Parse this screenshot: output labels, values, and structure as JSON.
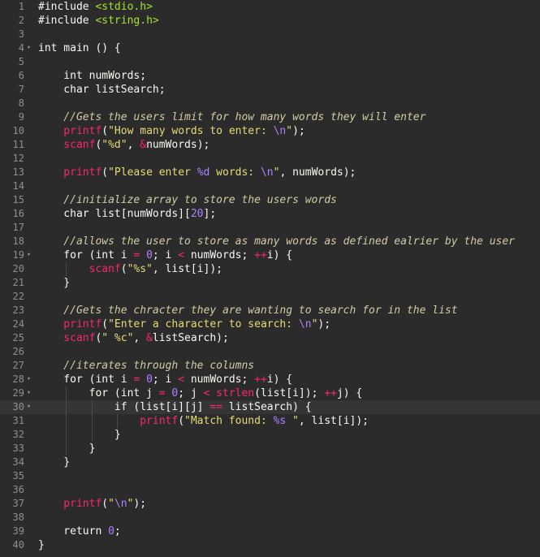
{
  "editor": {
    "colors": {
      "background": "#2b2b2b",
      "gutter_text": "#8f908a",
      "text": "#f8f8f2",
      "string": "#e6db74",
      "builtin": "#f92672",
      "number": "#ae81ff",
      "comment": "#d2cca5",
      "include": "#a6e22e"
    },
    "active_line": 30,
    "fold_lines": [
      4,
      19,
      28,
      29,
      30
    ],
    "lines": [
      [
        [
          "def",
          "#include "
        ],
        [
          "inc",
          "<stdio.h>"
        ]
      ],
      [
        [
          "def",
          "#include "
        ],
        [
          "inc",
          "<string.h>"
        ]
      ],
      [],
      [
        [
          "def",
          "int main () {"
        ]
      ],
      [],
      [
        [
          "def",
          "    int numWords;"
        ]
      ],
      [
        [
          "def",
          "    char listSearch;"
        ]
      ],
      [],
      [
        [
          "cmt",
          "    //Gets the users limit for how many words they will enter"
        ]
      ],
      [
        [
          "fn",
          "    printf"
        ],
        [
          "def",
          "("
        ],
        [
          "str",
          "\"How many words to enter: "
        ],
        [
          "esc",
          "\\n"
        ],
        [
          "str",
          "\""
        ],
        [
          "def",
          ");"
        ]
      ],
      [
        [
          "fn",
          "    scanf"
        ],
        [
          "def",
          "("
        ],
        [
          "str",
          "\"%d\""
        ],
        [
          "def",
          ", "
        ],
        [
          "op",
          "&"
        ],
        [
          "def",
          "numWords);"
        ]
      ],
      [],
      [
        [
          "fn",
          "    printf"
        ],
        [
          "def",
          "("
        ],
        [
          "str",
          "\"Please enter "
        ],
        [
          "esc",
          "%d"
        ],
        [
          "str",
          " words: "
        ],
        [
          "esc",
          "\\n"
        ],
        [
          "str",
          "\""
        ],
        [
          "def",
          ", numWords);"
        ]
      ],
      [],
      [
        [
          "cmt",
          "    //initialize array to store the users words"
        ]
      ],
      [
        [
          "def",
          "    char list[numWords]["
        ],
        [
          "num",
          "20"
        ],
        [
          "def",
          "];"
        ]
      ],
      [],
      [
        [
          "cmt",
          "    //allows the user to store as many words as defined ealrier by the user"
        ]
      ],
      [
        [
          "def",
          "    for (int i "
        ],
        [
          "op",
          "="
        ],
        [
          "def",
          " "
        ],
        [
          "num",
          "0"
        ],
        [
          "def",
          "; i "
        ],
        [
          "op",
          "<"
        ],
        [
          "def",
          " numWords; "
        ],
        [
          "op",
          "++"
        ],
        [
          "def",
          "i) {"
        ]
      ],
      [
        [
          "fn",
          "        scanf"
        ],
        [
          "def",
          "("
        ],
        [
          "str",
          "\"%s\""
        ],
        [
          "def",
          ", list[i]);"
        ]
      ],
      [
        [
          "def",
          "    }"
        ]
      ],
      [],
      [
        [
          "cmt",
          "    //Gets the chracter they are wanting to search for in the list"
        ]
      ],
      [
        [
          "fn",
          "    printf"
        ],
        [
          "def",
          "("
        ],
        [
          "str",
          "\"Enter a character to search: "
        ],
        [
          "esc",
          "\\n"
        ],
        [
          "str",
          "\""
        ],
        [
          "def",
          ");"
        ]
      ],
      [
        [
          "fn",
          "    scanf"
        ],
        [
          "def",
          "("
        ],
        [
          "str",
          "\" %c\""
        ],
        [
          "def",
          ", "
        ],
        [
          "op",
          "&"
        ],
        [
          "def",
          "listSearch);"
        ]
      ],
      [],
      [
        [
          "cmt",
          "    //iterates through the columns"
        ]
      ],
      [
        [
          "def",
          "    for (int i "
        ],
        [
          "op",
          "="
        ],
        [
          "def",
          " "
        ],
        [
          "num",
          "0"
        ],
        [
          "def",
          "; i "
        ],
        [
          "op",
          "<"
        ],
        [
          "def",
          " numWords; "
        ],
        [
          "op",
          "++"
        ],
        [
          "def",
          "i) {"
        ]
      ],
      [
        [
          "def",
          "        for (int j "
        ],
        [
          "op",
          "="
        ],
        [
          "def",
          " "
        ],
        [
          "num",
          "0"
        ],
        [
          "def",
          "; j "
        ],
        [
          "op",
          "<"
        ],
        [
          "def",
          " "
        ],
        [
          "fn",
          "strlen"
        ],
        [
          "def",
          "(list[i]); "
        ],
        [
          "op",
          "++"
        ],
        [
          "def",
          "j) {"
        ]
      ],
      [
        [
          "def",
          "            if (list[i][j] "
        ],
        [
          "op",
          "=="
        ],
        [
          "def",
          " listSearch) {"
        ]
      ],
      [
        [
          "fn",
          "                printf"
        ],
        [
          "def",
          "("
        ],
        [
          "str",
          "\"Match found: "
        ],
        [
          "esc",
          "%s"
        ],
        [
          "str",
          " \""
        ],
        [
          "def",
          ", list[i]);"
        ]
      ],
      [
        [
          "def",
          "            }"
        ]
      ],
      [
        [
          "def",
          "        }"
        ]
      ],
      [
        [
          "def",
          "    }"
        ]
      ],
      [],
      [],
      [
        [
          "fn",
          "    printf"
        ],
        [
          "def",
          "("
        ],
        [
          "str",
          "\""
        ],
        [
          "esc",
          "\\n"
        ],
        [
          "str",
          "\""
        ],
        [
          "def",
          ");"
        ]
      ],
      [],
      [
        [
          "def",
          "    return "
        ],
        [
          "num",
          "0"
        ],
        [
          "def",
          ";"
        ]
      ],
      [
        [
          "def",
          "}"
        ]
      ]
    ]
  }
}
